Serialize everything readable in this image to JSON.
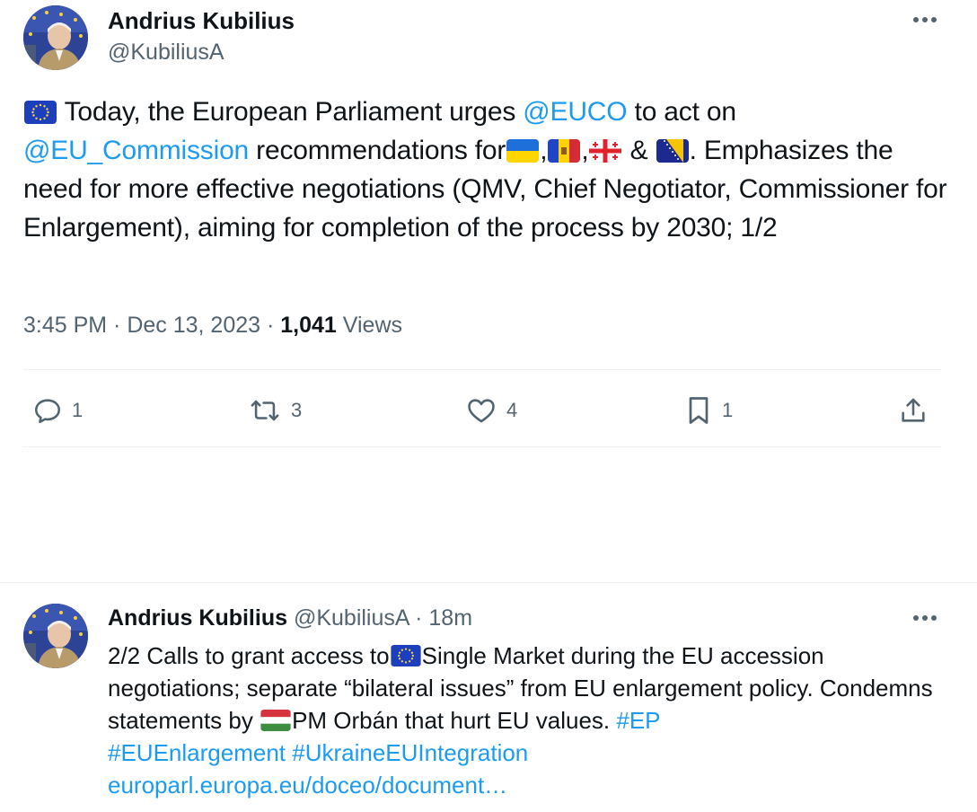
{
  "tweet1": {
    "author_name": "Andrius Kubilius",
    "handle": "@KubiliusA",
    "text_a": " Today, the European Parliament urges ",
    "mention_euco": "@EUCO",
    "text_b": " to act on ",
    "mention_commission": "@EU_Commission",
    "text_c": " recommendations for",
    "comma1": ",",
    "comma2": ",",
    "amp": " & ",
    "text_d": ". Emphasizes the need for more effective negotiations (QMV, Chief Negotiator, Commissioner for Enlargement), aiming for completion of the process by 2030; 1/2",
    "time": "3:45 PM",
    "sep": " · ",
    "date": "Dec 13, 2023",
    "views_count": "1,041",
    "views_label": " Views",
    "actions": {
      "replies": "1",
      "reposts": "3",
      "likes": "4",
      "bookmarks": "1"
    }
  },
  "tweet2": {
    "author_name": "Andrius Kubilius",
    "handle": "@KubiliusA",
    "dot": " · ",
    "time_ago": "18m",
    "text_a": "2/2 Calls to grant access to",
    "text_b": "Single Market during the EU accession negotiations; separate “bilateral issues” from EU enlargement policy. Condemns statements by ",
    "text_c": "PM Orbán that hurt EU values. ",
    "hashtag_ep": "#EP",
    "hashtag_enlargement": "#EUEnlargement",
    "hashtag_ukraine": "#UkraineEUIntegration",
    "link": "europarl.europa.eu/doceo/document…"
  },
  "icons": [
    "more-icon",
    "reply-icon",
    "repost-icon",
    "like-icon",
    "bookmark-icon",
    "share-icon"
  ],
  "colors": {
    "accent": "#1d9bf0",
    "text": "#0f1419",
    "secondary": "#536471",
    "divider": "#eff3f4"
  }
}
